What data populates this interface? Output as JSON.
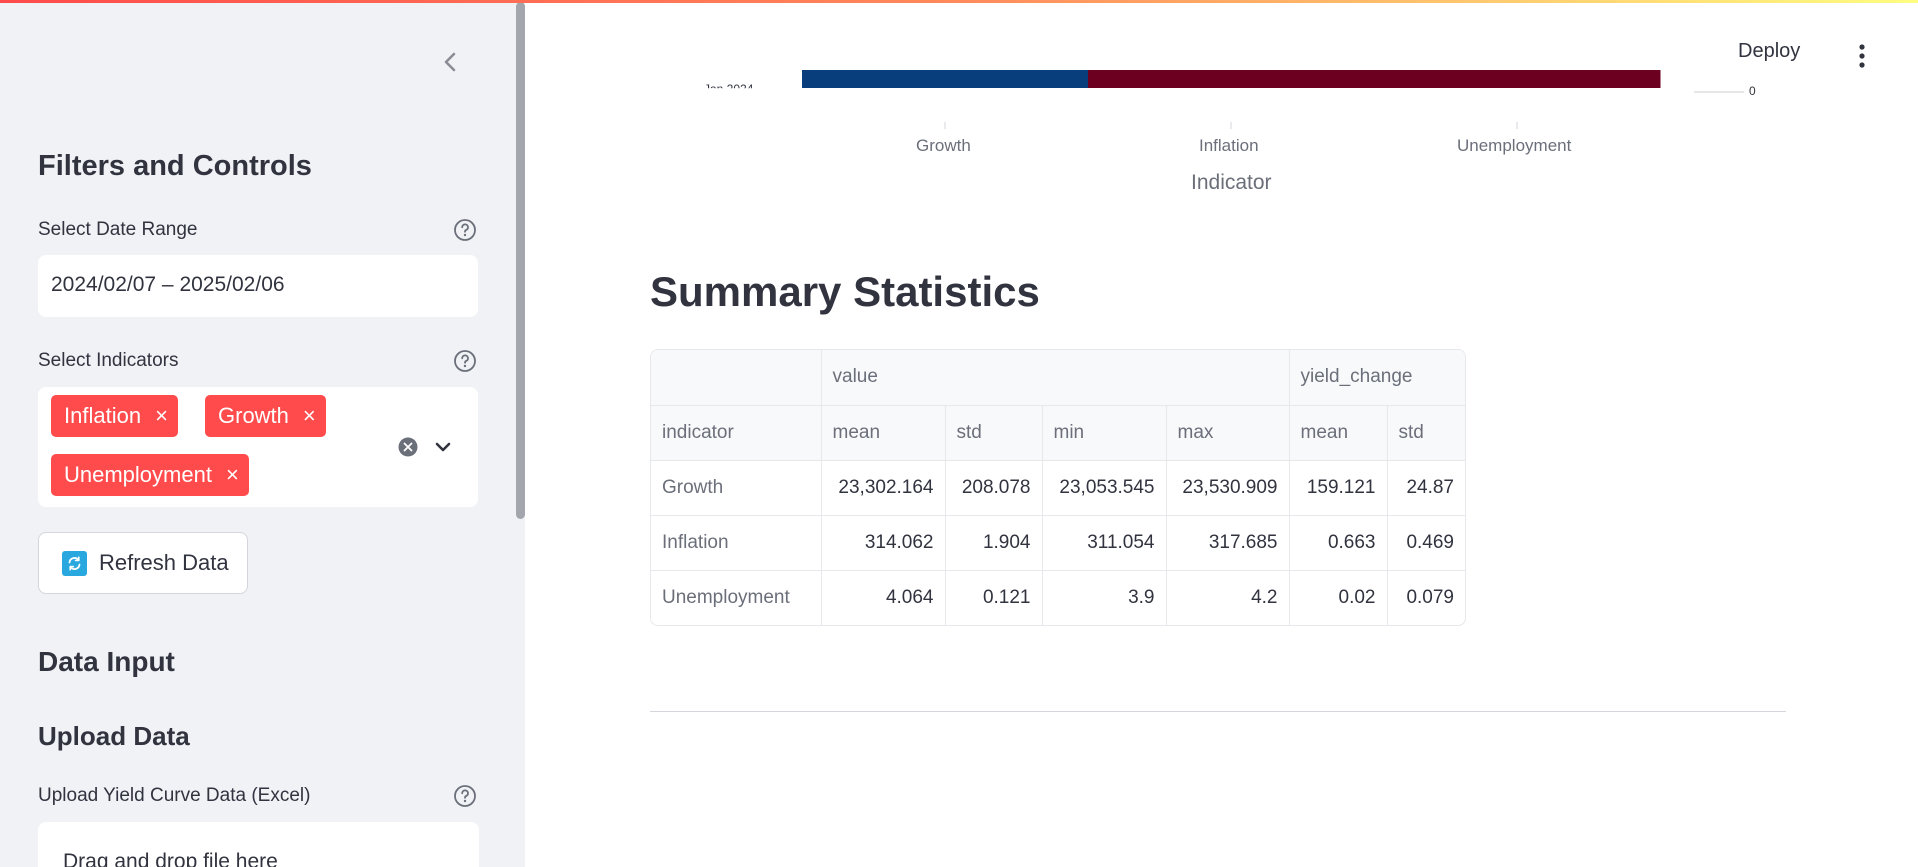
{
  "sidebar": {
    "filters_title": "Filters and Controls",
    "date_range_label": "Select Date Range",
    "date_range_value": "2024/02/07 – 2025/02/06",
    "indicators_label": "Select Indicators",
    "selected_indicators": [
      "Inflation",
      "Growth",
      "Unemployment"
    ],
    "refresh_label": "Refresh Data",
    "data_input_title": "Data Input",
    "upload_title": "Upload Data",
    "upload_label": "Upload Yield Curve Data (Excel)",
    "dropzone_text": "Drag and drop file here"
  },
  "header": {
    "deploy_label": "Deploy"
  },
  "chart_data": {
    "type": "heatmap",
    "partial": true,
    "categories": [
      "Growth",
      "Inflation",
      "Unemployment"
    ],
    "xlabel": "Indicator",
    "visible_row_colors": [
      "#083e7c",
      "#6b0020",
      "#6b0020"
    ],
    "colorbar_visible_tick": "0",
    "y_visible_tick": "Jan 2024"
  },
  "summary": {
    "title": "Summary Statistics",
    "group_headers": [
      "",
      "value",
      "yield_change"
    ],
    "columns": [
      "indicator",
      "mean",
      "std",
      "min",
      "max",
      "mean",
      "std"
    ],
    "rows": [
      [
        "Growth",
        "23,302.164",
        "208.078",
        "23,053.545",
        "23,530.909",
        "159.121",
        "24.87"
      ],
      [
        "Inflation",
        "314.062",
        "1.904",
        "311.054",
        "317.685",
        "0.663",
        "0.469"
      ],
      [
        "Unemployment",
        "4.064",
        "0.121",
        "3.9",
        "4.2",
        "0.02",
        "0.079"
      ]
    ]
  }
}
